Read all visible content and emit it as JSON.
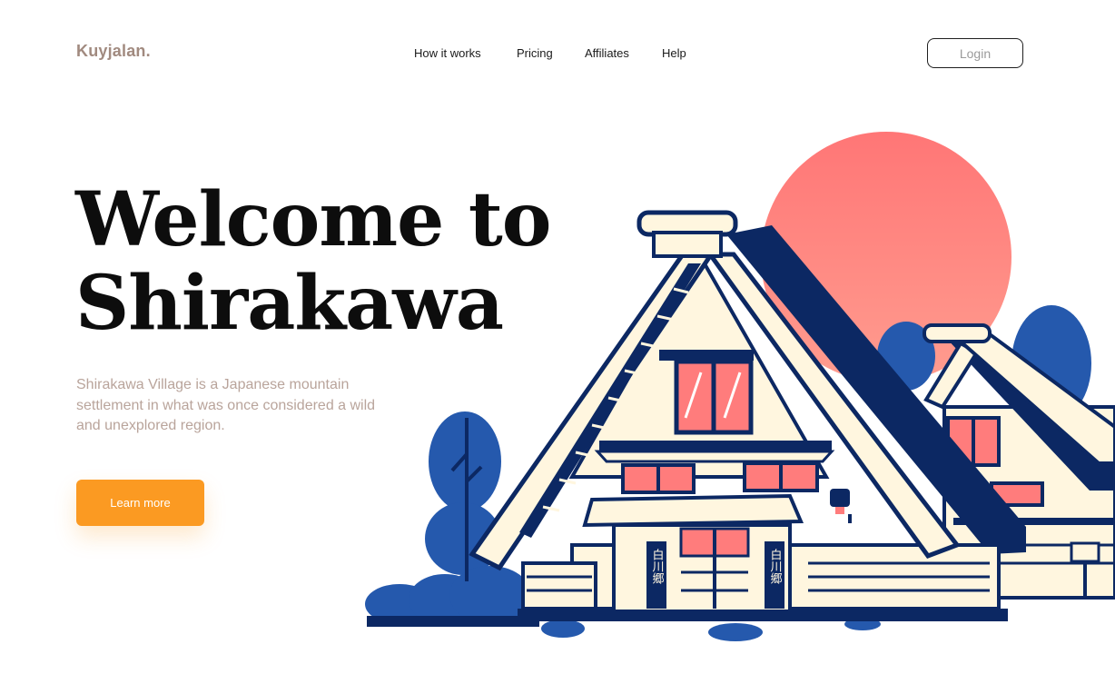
{
  "brand": {
    "name": "Kuyjalan."
  },
  "nav": {
    "items": [
      {
        "label": "How it works"
      },
      {
        "label": "Pricing"
      },
      {
        "label": "Affiliates"
      },
      {
        "label": "Help"
      }
    ],
    "login_label": "Login"
  },
  "hero": {
    "title_line1": "Welcome to",
    "title_line2": "Shirakawa",
    "description": "Shirakawa Village is a Japanese mountain settlement in what was once considered a wild and unexplored region.",
    "cta_label": "Learn more"
  },
  "illustration": {
    "sign_text": "白川郷"
  },
  "colors": {
    "brand": "#a18a7f",
    "accent": "#fb9a22",
    "sun": "#ff7b7b",
    "navy": "#0c2863",
    "tree_blue": "#2559ad",
    "cream": "#fff6df",
    "window": "#ff7c7c"
  }
}
